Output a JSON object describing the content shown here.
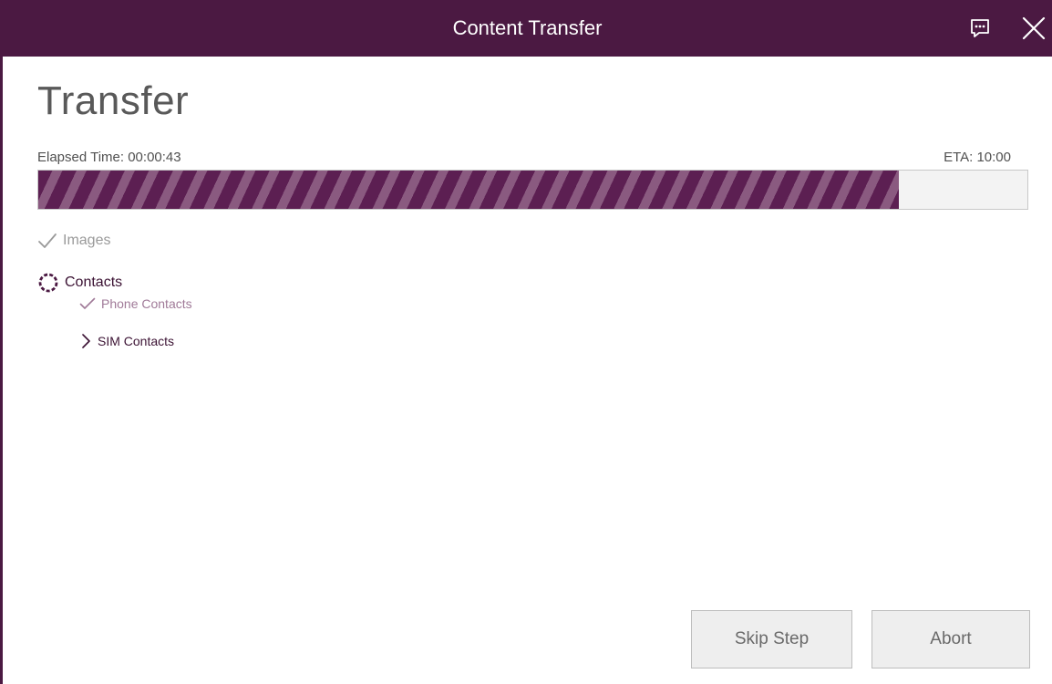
{
  "window": {
    "title": "Content Transfer"
  },
  "page": {
    "title": "Transfer"
  },
  "progress": {
    "elapsed_label": "Elapsed Time: 00:00:43",
    "eta_label": "ETA: 10:00",
    "fraction": 0.87
  },
  "steps": {
    "images": {
      "label": "Images",
      "status": "done"
    },
    "contacts": {
      "label": "Contacts",
      "status": "in-progress",
      "sub": {
        "phone": {
          "label": "Phone Contacts",
          "status": "done"
        },
        "sim": {
          "label": "SIM Contacts",
          "status": "current"
        }
      }
    }
  },
  "buttons": {
    "skip": "Skip Step",
    "abort": "Abort"
  },
  "colors": {
    "accent": "#4b1942",
    "stripe_dark": "#5c1f52",
    "stripe_light": "#8a5a80"
  },
  "icons": {
    "feedback": "feedback-icon",
    "close": "close-icon",
    "check": "check-icon",
    "spinner": "spinner-icon",
    "chevron": "chevron-right-icon"
  }
}
